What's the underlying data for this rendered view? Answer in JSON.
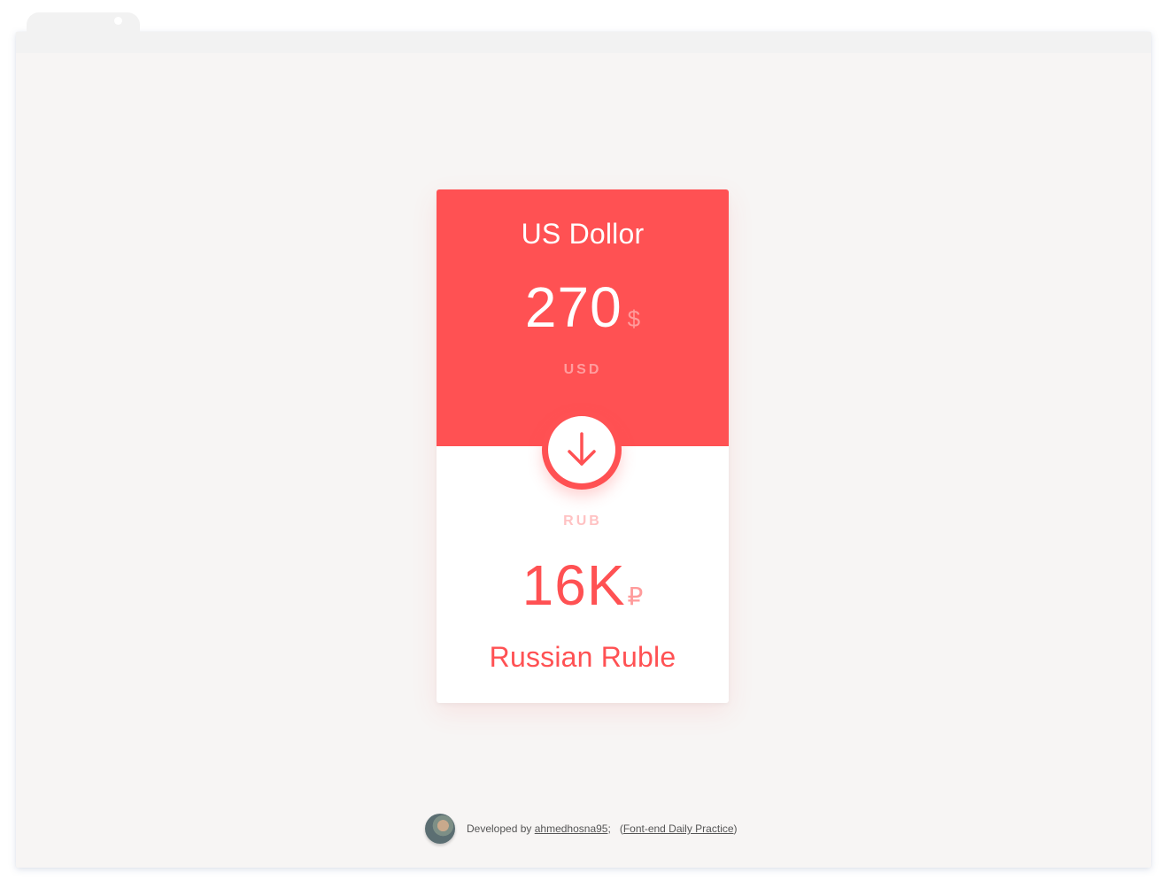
{
  "converter": {
    "from": {
      "name": "US Dollor",
      "amount": "270",
      "symbol": "$",
      "code": "USD"
    },
    "to": {
      "name": "Russian Ruble",
      "amount": "16K",
      "symbol": "₽",
      "code": "RUB"
    },
    "convert_icon": "arrow-down-icon",
    "colors": {
      "accent": "#ff5153",
      "background": "#f7f5f4",
      "card": "#ffffff",
      "muted_on_accent": "#ff9d9e",
      "muted_on_white": "#ffc2c3"
    }
  },
  "footer": {
    "prefix": "Developed by",
    "author": "ahmedhosna95",
    "separator": ";",
    "open_paren": "(",
    "project": "Font-end Daily Practice",
    "close_paren": ")"
  }
}
